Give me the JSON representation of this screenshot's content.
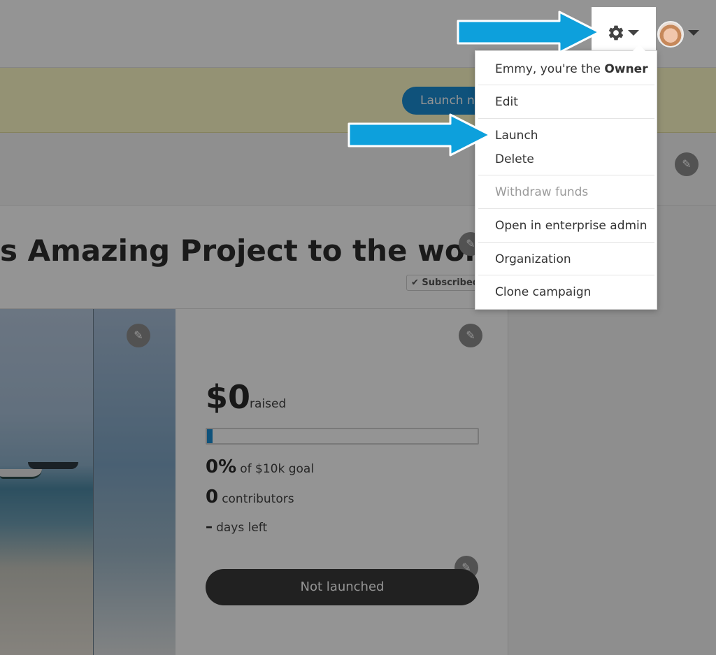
{
  "banner": {
    "launch_button": "Launch no"
  },
  "project": {
    "title": "s Amazing Project to the world!",
    "subscribed_label": "Subscribed"
  },
  "stats": {
    "raised_amount": "$0",
    "raised_label": "raised",
    "progress_fraction": 0.02,
    "percent": "0%",
    "goal_text": "of $10k goal",
    "contributors_count": "0",
    "contributors_label": "contributors",
    "days_value": "–",
    "days_label": "days left",
    "status_button": "Not launched"
  },
  "menu": {
    "owner_prefix": "Emmy, you're the ",
    "owner_role": "Owner",
    "items": [
      {
        "label": "Edit"
      },
      {
        "label": "Launch"
      },
      {
        "label": "Delete"
      },
      {
        "label": "Withdraw funds",
        "disabled": true
      },
      {
        "label": "Open in enterprise admin"
      },
      {
        "label": "Organization"
      },
      {
        "label": "Clone campaign"
      }
    ]
  },
  "icons": {
    "settings": "gear-icon",
    "edit": "pencil-icon",
    "check": "check-icon",
    "callout": "arrow-icon"
  },
  "colors": {
    "accent": "#1a8ed4",
    "callout_arrow": "#0da0dc",
    "banner": "#fffbc9",
    "dark_button": "#3a3a3a"
  }
}
